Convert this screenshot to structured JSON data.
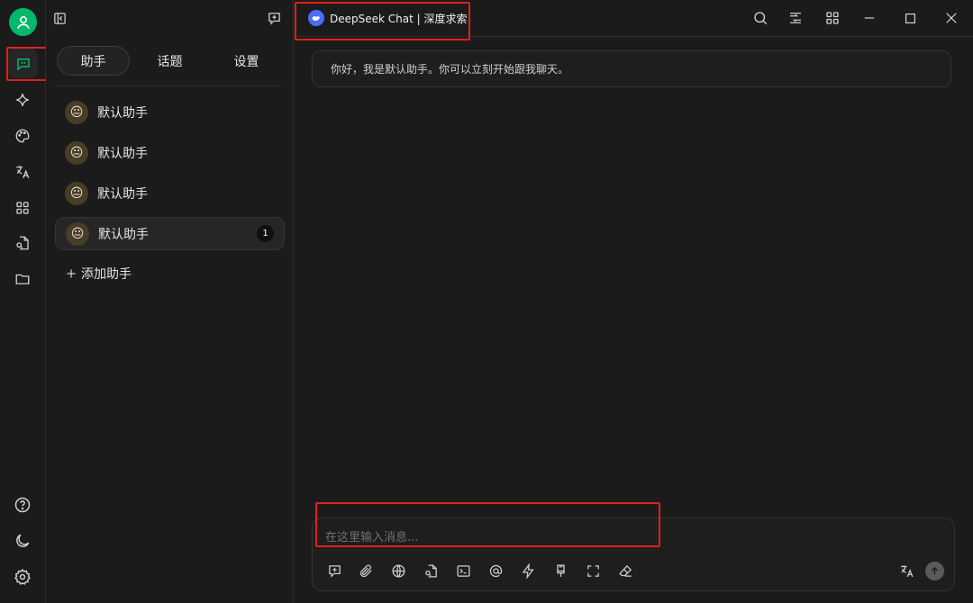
{
  "sidebar": {
    "icons": [
      "user-avatar-icon",
      "chat-icon",
      "sparkle-icon",
      "palette-icon",
      "translate-icon",
      "apps-grid-icon",
      "file-search-icon",
      "folder-icon",
      "help-icon",
      "moon-icon",
      "settings-icon"
    ]
  },
  "panel": {
    "tabs": [
      {
        "label": "助手",
        "active": true
      },
      {
        "label": "话题",
        "active": false
      },
      {
        "label": "设置",
        "active": false
      }
    ],
    "assistants": [
      {
        "name": "默认助手",
        "emoji": "😐",
        "count": ""
      },
      {
        "name": "默认助手",
        "emoji": "😐",
        "count": ""
      },
      {
        "name": "默认助手",
        "emoji": "😐",
        "count": ""
      },
      {
        "name": "默认助手",
        "emoji": "😐",
        "count": "1"
      }
    ],
    "add_label": "添加助手"
  },
  "header": {
    "model_name": "DeepSeek Chat | 深度求索"
  },
  "chat": {
    "messages": [
      {
        "text": "你好，我是默认助手。你可以立刻开始跟我聊天。"
      }
    ]
  },
  "composer": {
    "placeholder": "在这里输入消息...",
    "value": "",
    "tools": [
      "new-topic-icon",
      "attachment-icon",
      "web-search-icon",
      "knowledge-icon",
      "terminal-icon",
      "mention-icon",
      "lightning-icon",
      "paint-brush-icon",
      "fullscreen-icon",
      "eraser-icon"
    ]
  },
  "colors": {
    "accent": "#00b96b",
    "highlight": "#e0201c",
    "model_logo": "#4d6bfe"
  }
}
